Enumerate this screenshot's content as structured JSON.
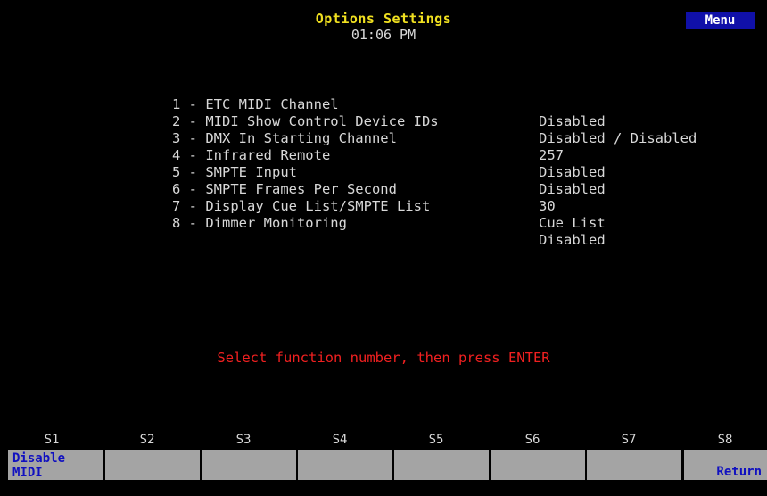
{
  "header": {
    "title": "Options Settings",
    "time": "01:06 PM",
    "menu_label": "Menu"
  },
  "options": [
    {
      "label": "1 - ETC MIDI Channel",
      "value": "Disabled"
    },
    {
      "label": "2 - MIDI Show Control Device IDs",
      "value": "Disabled / Disabled"
    },
    {
      "label": "3 - DMX In Starting Channel",
      "value": "257"
    },
    {
      "label": "4 - Infrared Remote",
      "value": "Disabled"
    },
    {
      "label": "5 - SMPTE Input",
      "value": "Disabled"
    },
    {
      "label": "6 - SMPTE Frames Per Second",
      "value": "30"
    },
    {
      "label": "7 - Display Cue List/SMPTE List",
      "value": "Cue List"
    },
    {
      "label": "8 - Dimmer Monitoring",
      "value": "Disabled"
    }
  ],
  "prompt": "Select function number, then press ENTER",
  "softkeys": [
    {
      "id": "S1",
      "text": "Disable\nMIDI"
    },
    {
      "id": "S2",
      "text": ""
    },
    {
      "id": "S3",
      "text": ""
    },
    {
      "id": "S4",
      "text": ""
    },
    {
      "id": "S5",
      "text": ""
    },
    {
      "id": "S6",
      "text": ""
    },
    {
      "id": "S7",
      "text": ""
    },
    {
      "id": "S8",
      "text": "Return"
    }
  ],
  "colors": {
    "background": "#000000",
    "title": "#f0e020",
    "text": "#d8d8d8",
    "prompt": "#f02020",
    "menu_bg": "#1010a8",
    "softkey_bg": "#a4a4a4",
    "softkey_text": "#1010c0"
  }
}
